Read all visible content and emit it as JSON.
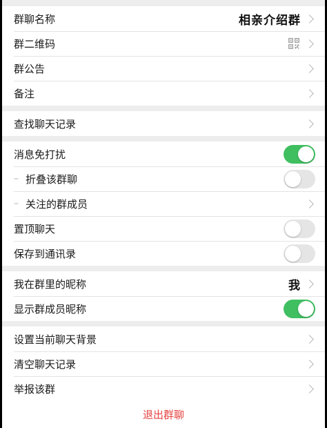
{
  "colors": {
    "accent_green": "#3fbf60",
    "danger_red": "#e64340",
    "background": "#ededed"
  },
  "group1": {
    "group_name_label": "群聊名称",
    "group_name_value": "相亲介绍群",
    "qr_label": "群二维码",
    "notice_label": "群公告",
    "remark_label": "备注"
  },
  "group2": {
    "search_history_label": "查找聊天记录"
  },
  "group3": {
    "mute_label": "消息免打扰",
    "mute_on": true,
    "fold_label": "折叠该群聊",
    "fold_on": false,
    "followed_members_label": "关注的群成员",
    "pin_label": "置顶聊天",
    "pin_on": false,
    "save_contacts_label": "保存到通讯录",
    "save_contacts_on": false
  },
  "group4": {
    "my_nickname_label": "我在群里的昵称",
    "my_nickname_value": "我",
    "show_nicknames_label": "显示群成员昵称",
    "show_nicknames_on": true
  },
  "group5": {
    "background_label": "设置当前聊天背景",
    "clear_history_label": "清空聊天记录",
    "report_label": "举报该群"
  },
  "exit_label": "退出群聊",
  "icons": [
    "qr-code-icon",
    "chevron-right-icon",
    "toggle-switch"
  ]
}
